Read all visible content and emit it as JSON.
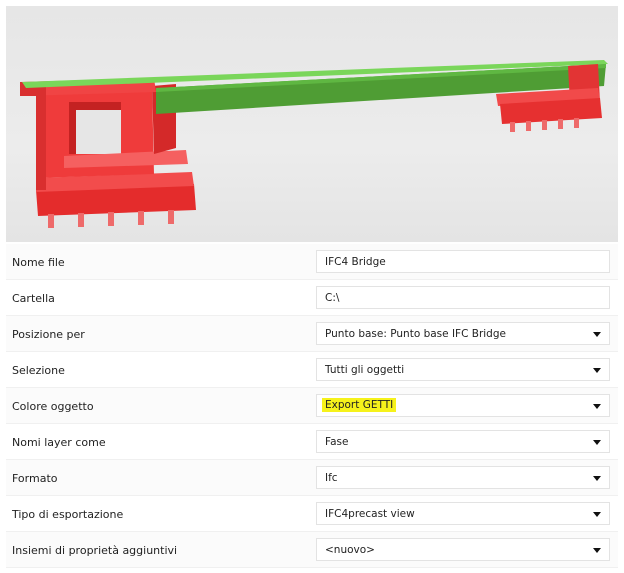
{
  "colors": {
    "deck_top": "#6fcf52",
    "deck_side": "#4e9a33",
    "abutment": "#ee3a3a",
    "abutment_dark": "#b81c1c",
    "highlight": "#f6f21b"
  },
  "properties": [
    {
      "label": "Nome file",
      "value": "IFC4 Bridge",
      "type": "text"
    },
    {
      "label": "Cartella",
      "value": "C:\\",
      "type": "text"
    },
    {
      "label": "Posizione per",
      "value": "Punto base: Punto base IFC Bridge",
      "type": "select"
    },
    {
      "label": "Selezione",
      "value": "Tutti gli oggetti",
      "type": "select"
    },
    {
      "label": "Colore oggetto",
      "value": "Export GETTI",
      "type": "select",
      "highlighted": true
    },
    {
      "label": "Nomi layer come",
      "value": "Fase",
      "type": "select"
    },
    {
      "label": "Formato",
      "value": "Ifc",
      "type": "select"
    },
    {
      "label": "Tipo di esportazione",
      "value": "IFC4precast view",
      "type": "select"
    },
    {
      "label": "Insiemi di proprietà aggiuntivi",
      "value": "<nuovo>",
      "type": "select"
    }
  ]
}
